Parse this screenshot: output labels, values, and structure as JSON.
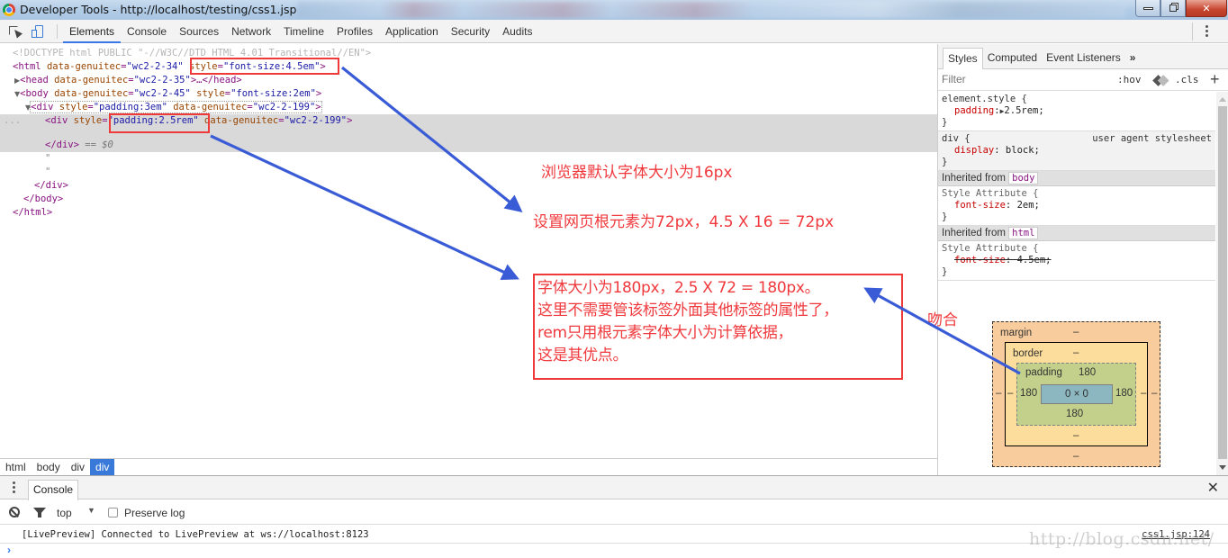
{
  "window": {
    "title": "Developer Tools - http://localhost/testing/css1.jsp",
    "controls": [
      "minimize",
      "restore",
      "close"
    ]
  },
  "toolbar": {
    "tabs": [
      "Elements",
      "Console",
      "Sources",
      "Network",
      "Timeline",
      "Profiles",
      "Application",
      "Security",
      "Audits"
    ],
    "active_tab": "Elements"
  },
  "elements": {
    "doctype": "<!DOCTYPE html PUBLIC \"-//W3C//DTD HTML 4.01 Transitional//EN\">",
    "html_tag": {
      "open": "<html",
      "attr1_name": "data-genuitec",
      "attr1_value": "\"wc2-2-34\"",
      "attr2_name": "style",
      "attr2_value": "\"font-size:4.5em\"",
      "close": ">"
    },
    "head_tag": {
      "open": "<head",
      "attr_name": "data-genuitec",
      "attr_value": "\"wc2-2-35\"",
      "mid": ">…",
      "close": "</head>"
    },
    "body_tag": {
      "open": "<body",
      "attr1_name": "data-genuitec",
      "attr1_value": "\"wc2-2-45\"",
      "attr2_name": "style",
      "attr2_value": "\"font-size:2em\"",
      "close": ">"
    },
    "div_outer": {
      "open": "<div",
      "attr1_name": "style",
      "attr1_value": "\"padding:3em\"",
      "attr2_name": "data-genuitec",
      "attr2_value": "\"wc2-2-199\"",
      "close": ">"
    },
    "div_inner": {
      "open": "<div",
      "attr1_name": "style",
      "attr1_value": "\"padding:2.5rem\"",
      "attr2_name": "data-genuitec",
      "attr2_value": "\"wc2-2-199\"",
      "close": ">"
    },
    "div_inner_close": "</div>",
    "dollar_zero": "== $0",
    "text_node": "\"",
    "div_close": "</div>",
    "body_close": "</body>",
    "html_close": "</html>",
    "gutter_ellipsis": "..."
  },
  "breadcrumb": [
    "html",
    "body",
    "div",
    "div"
  ],
  "breadcrumb_active": "div",
  "sidebar": {
    "tabs": [
      "Styles",
      "Computed",
      "Event Listeners"
    ],
    "more": "»",
    "active_tab": "Styles",
    "filter_placeholder": "Filter",
    "hov": ":hov",
    "cls": ".cls",
    "plus": "+",
    "rules": {
      "element_style": {
        "selector": "element.style {",
        "prop": "padding",
        "value": "2.5rem;",
        "close": "}"
      },
      "div": {
        "selector": "div {",
        "source": "user agent stylesheet",
        "prop": "display",
        "value": "block;",
        "close": "}"
      },
      "inherited_body": {
        "label": "Inherited from",
        "chip": "body",
        "selector": "Style Attribute {",
        "prop": "font-size",
        "value": "2em;",
        "close": "}"
      },
      "inherited_html": {
        "label": "Inherited from",
        "chip": "html",
        "selector": "Style Attribute {",
        "prop": "font-size",
        "value": "4.5em;",
        "overridden": true,
        "close": "}"
      }
    },
    "box_model": {
      "margin_label": "margin",
      "margin_top": "–",
      "margin_bottom": "–",
      "margin_left": "–",
      "margin_right": "–",
      "border_label": "border",
      "border_top": "–",
      "border_bottom": "–",
      "border_left": "–",
      "border_right": "–",
      "padding_label": "padding",
      "padding_top": "180",
      "padding_bottom": "180",
      "padding_left": "180",
      "padding_right": "180",
      "content": "0 × 0"
    }
  },
  "drawer": {
    "tab": "Console",
    "context": "top",
    "preserve_log_label": "Preserve log",
    "preserve_log_checked": false,
    "messages": [
      {
        "text": "[LivePreview] Connected to LivePreview at ws://localhost:8123",
        "source": "css1.jsp:124"
      }
    ],
    "prompt": "›"
  },
  "annotations": {
    "note1": "浏览器默认字体大小为16px",
    "note2": "设置网页根元素为72px，4.5 X 16 = 72px",
    "box_lines": [
      "字体大小为180px，2.5 X 72 = 180px。",
      "这里不需要管该标签外面其他标签的属性了，",
      "rem只用根元素字体大小为计算依据，",
      "这是其优点。"
    ],
    "note3": "吻合",
    "text_color": "#f0393d",
    "arrow_color": "#3a5bd6"
  },
  "watermark": "http://blog.csdn.net/"
}
